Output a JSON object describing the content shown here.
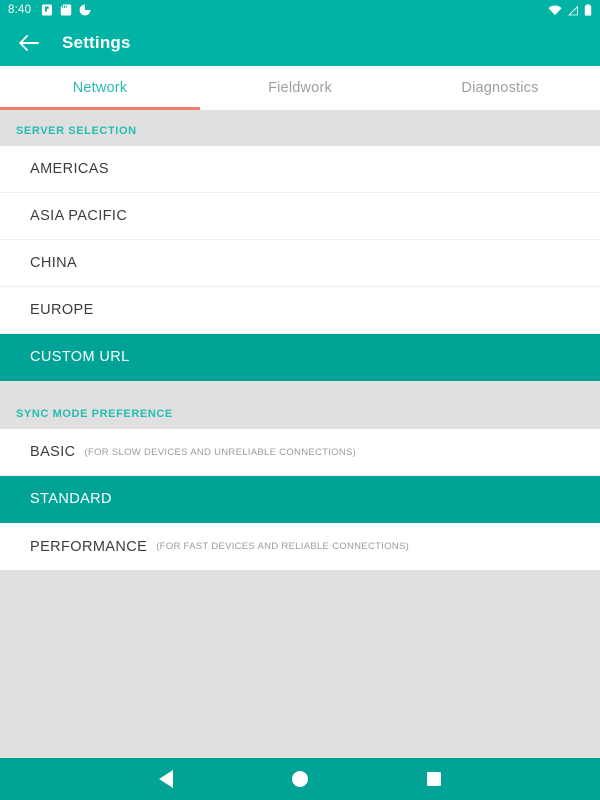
{
  "status_bar": {
    "time": "8:40",
    "left_icons": [
      "note-icon",
      "sd-card-icon",
      "pie-chart-icon"
    ],
    "right_icons": [
      "wifi-icon",
      "signal-icon",
      "battery-icon"
    ]
  },
  "app_bar": {
    "back_icon": "arrow-left-icon",
    "title": "Settings"
  },
  "tabs": [
    {
      "label": "Network",
      "active": true
    },
    {
      "label": "Fieldwork",
      "active": false
    },
    {
      "label": "Diagnostics",
      "active": false
    }
  ],
  "sections": [
    {
      "header": "SERVER SELECTION",
      "rows": [
        {
          "label": "AMERICAS",
          "sublabel": "",
          "selected": false
        },
        {
          "label": "ASIA PACIFIC",
          "sublabel": "",
          "selected": false
        },
        {
          "label": "CHINA",
          "sublabel": "",
          "selected": false
        },
        {
          "label": "EUROPE",
          "sublabel": "",
          "selected": false
        },
        {
          "label": "CUSTOM URL",
          "sublabel": "",
          "selected": true
        }
      ]
    },
    {
      "header": "SYNC MODE PREFERENCE",
      "rows": [
        {
          "label": "BASIC",
          "sublabel": "(FOR SLOW DEVICES AND UNRELIABLE CONNECTIONS)",
          "selected": false
        },
        {
          "label": "STANDARD",
          "sublabel": "",
          "selected": true
        },
        {
          "label": "PERFORMANCE",
          "sublabel": "(FOR FAST DEVICES AND RELIABLE CONNECTIONS)",
          "selected": false
        }
      ]
    }
  ],
  "nav_bar": {
    "back_icon": "triangle-back-icon",
    "home_icon": "circle-home-icon",
    "recents_icon": "square-recents-icon"
  },
  "colors": {
    "teal_appbar": "#00b3a4",
    "teal_selected": "#00a396",
    "teal_text": "#26bdb0",
    "tab_indicator": "#ee7c68",
    "gray_band": "#e0e0e0",
    "row_bg": "#ffffff",
    "label_text": "#3c3c3c",
    "sublabel_text": "#9b9b9b"
  }
}
